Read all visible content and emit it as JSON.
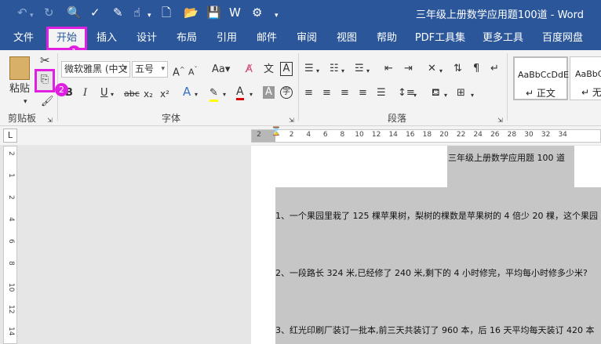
{
  "window": {
    "title": "三年级上册数学应用题100道 - Word"
  },
  "tabs": [
    {
      "label": "文件"
    },
    {
      "label": "开始"
    },
    {
      "label": "插入"
    },
    {
      "label": "设计"
    },
    {
      "label": "布局"
    },
    {
      "label": "引用"
    },
    {
      "label": "邮件"
    },
    {
      "label": "审阅"
    },
    {
      "label": "视图"
    },
    {
      "label": "帮助"
    },
    {
      "label": "PDF工具集"
    },
    {
      "label": "更多工具"
    },
    {
      "label": "百度网盘"
    }
  ],
  "annotations": {
    "badge1": "1",
    "badge2": "2"
  },
  "clipboard": {
    "paste_label": "粘贴",
    "group_label": "剪贴板"
  },
  "font": {
    "name": "微软雅黑 (中文",
    "size": "五号",
    "group_label": "字体"
  },
  "paragraph": {
    "group_label": "段落"
  },
  "styles": [
    {
      "sample": "AaBbCcDdE",
      "name": "正文"
    },
    {
      "sample": "AaBbCcDdE",
      "name": "无间"
    }
  ],
  "ruler": {
    "corner": "L",
    "top_ticks": [
      "2",
      "2",
      "4",
      "6",
      "8",
      "10",
      "12",
      "14",
      "16",
      "18",
      "20",
      "22",
      "24",
      "26",
      "28",
      "30",
      "32",
      "34"
    ],
    "left_ticks": [
      "2",
      "1",
      "2",
      "4",
      "6",
      "8",
      "10",
      "12",
      "14"
    ]
  },
  "document": {
    "heading": "三年级上册数学应用题 100 道",
    "paragraphs": [
      "1、一个果园里栽了 125 棵苹果树，梨树的棵数是苹果树的 4 倍少 20 棵，这个果园",
      "2、一段路长 324 米,已经修了 240 米,剩下的 4 小时修完，平均每小时修多少米?",
      "3、红光印刷厂装订一批本,前三天共装订了 960 本，后 16 天平均每天装订 420 本"
    ]
  },
  "colors": {
    "brand": "#2b579a",
    "highlight": "#e020e0"
  }
}
